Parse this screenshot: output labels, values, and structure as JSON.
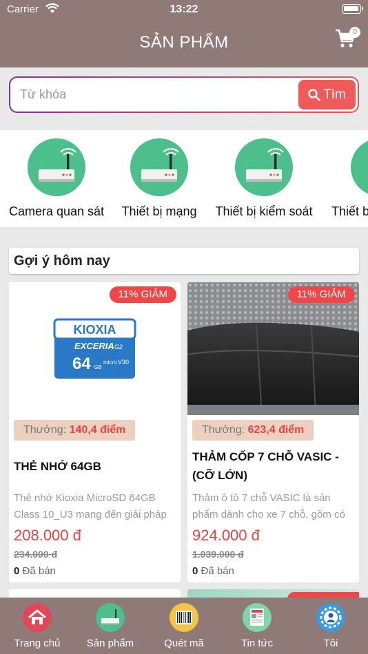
{
  "status_bar": {
    "carrier": "Carrier",
    "time": "13:22"
  },
  "header": {
    "title": "SẢN PHẨM",
    "cart_count": "0"
  },
  "search": {
    "placeholder": "Từ khóa",
    "button_label": "Tìm"
  },
  "categories": [
    {
      "label": "Camera quan sát",
      "icon": "router-icon"
    },
    {
      "label": "Thiết bị mạng",
      "icon": "router-icon"
    },
    {
      "label": "Thiết bị kiểm soát",
      "icon": "router-icon"
    },
    {
      "label": "Thiết b",
      "icon": "router-icon"
    }
  ],
  "suggestions": {
    "heading": "Gợi ý hôm nay",
    "products": [
      {
        "discount": "11% GIẢM",
        "reward_label": "Thưởng:",
        "reward_points": "140,4 điểm",
        "name": "THẺ NHỚ 64GB",
        "description": "Thẻ nhớ Kioxia MicroSD 64GB Class 10_U3 mang đến giải pháp",
        "price": "208.000 đ",
        "old_price": "234.000 đ",
        "sold_count": "0",
        "sold_label": "Đã bán",
        "image": {
          "brand": "KIOXIA",
          "line": "EXCERIA",
          "line_sub": "G2",
          "capacity": "64",
          "unit": "GB",
          "micro": "micro",
          "speed": "V30"
        }
      },
      {
        "discount": "11% GIẢM",
        "reward_label": "Thưởng:",
        "reward_points": "623,4 điểm",
        "name": "THẢM CỐP 7 CHỖ VASIC - (CỠ LỚN)",
        "description": "Thảm ô tô 7 chỗ VASIC là sản phẩm dành cho xe 7 chỗ, gồm có",
        "price": "924.000 đ",
        "old_price": "1.039.000 đ",
        "sold_count": "0",
        "sold_label": "Đã bán"
      }
    ]
  },
  "tabbar": [
    {
      "label": "Trang chủ",
      "icon": "home-icon",
      "color": "#e04757"
    },
    {
      "label": "Sản phẩm",
      "icon": "router-icon",
      "color": "#4cbf8d"
    },
    {
      "label": "Quét mã",
      "icon": "barcode-icon",
      "color": "#f5c542"
    },
    {
      "label": "Tin tức",
      "icon": "news-icon",
      "color": "#7fd6a6"
    },
    {
      "label": "Tôi",
      "icon": "user-gear-icon",
      "color": "#3a9bd8"
    }
  ],
  "colors": {
    "header_bg": "#8f7a78",
    "accent_red": "#ef4747",
    "category_green": "#4cbf8d"
  }
}
